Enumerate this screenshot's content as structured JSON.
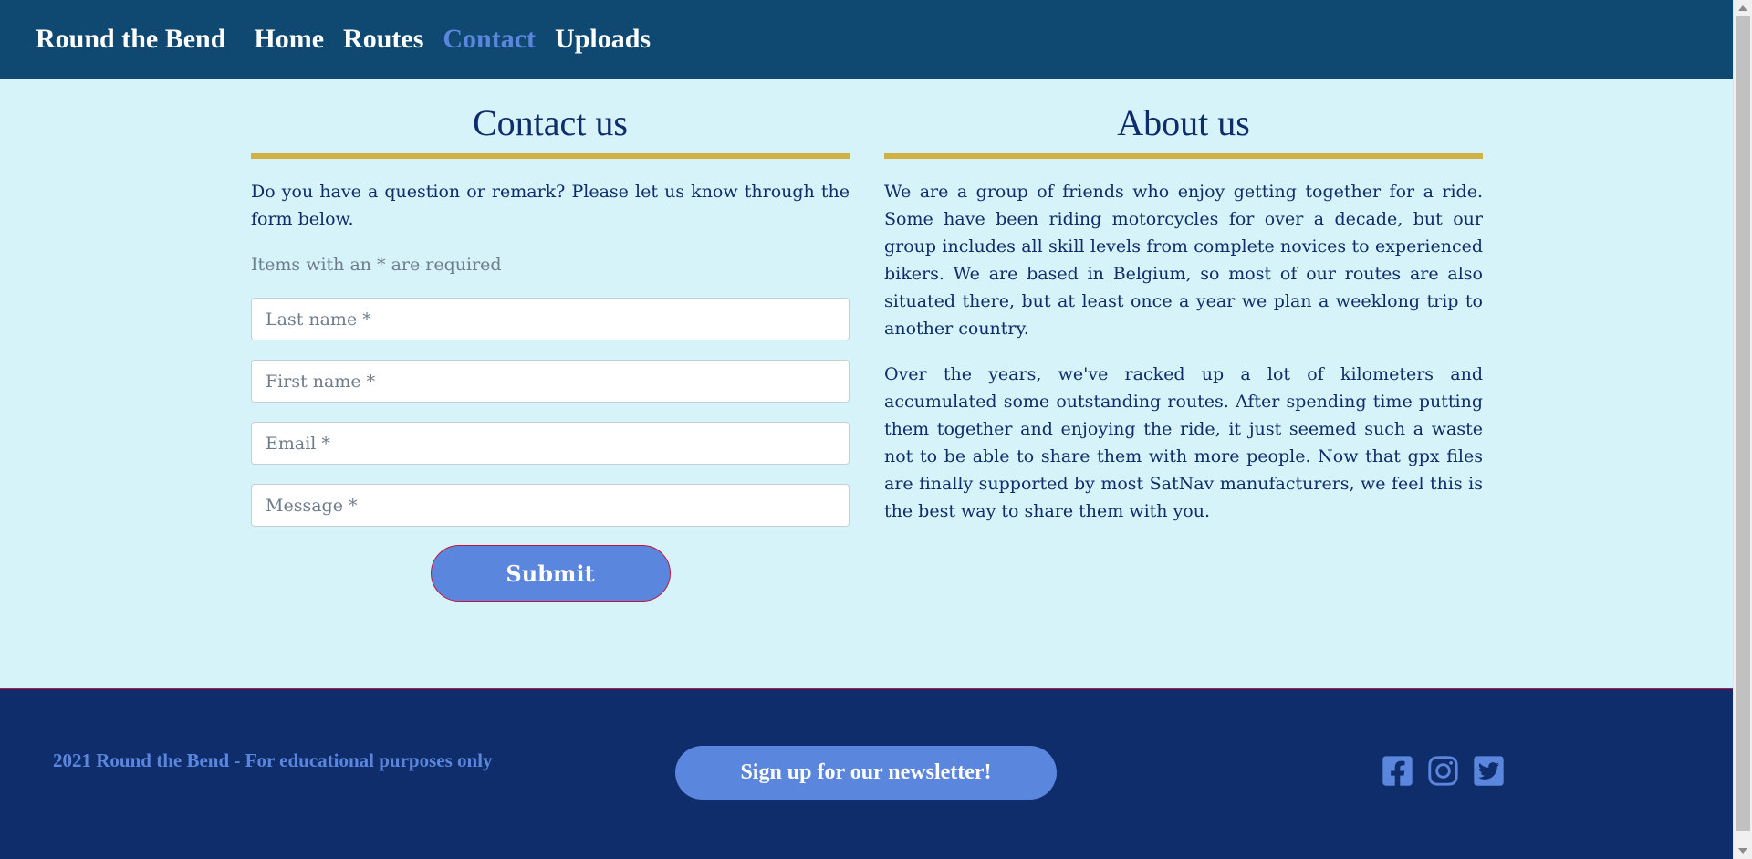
{
  "nav": {
    "brand": "Round the Bend",
    "links": [
      {
        "label": "Home"
      },
      {
        "label": "Routes"
      },
      {
        "label": "Contact"
      },
      {
        "label": "Uploads"
      }
    ]
  },
  "contact": {
    "title": "Contact us",
    "intro": "Do you have a question or remark? Please let us know through the form below.",
    "required_note": "Items with an * are required",
    "fields": {
      "last_name": {
        "placeholder": "Last name *",
        "value": ""
      },
      "first_name": {
        "placeholder": "First name *",
        "value": ""
      },
      "email": {
        "placeholder": "Email *",
        "value": ""
      },
      "message": {
        "placeholder": "Message *",
        "value": ""
      }
    },
    "submit_label": "Submit"
  },
  "about": {
    "title": "About us",
    "paragraphs": [
      "We are a group of friends who enjoy getting together for a ride. Some have been riding motorcycles for over a decade, but our group includes all skill levels from complete novices to experienced bikers. We are based in Belgium, so most of our routes are also situated there, but at least once a year we plan a weeklong trip to another country.",
      "Over the years, we've racked up a lot of kilometers and accumulated some outstanding routes. After spending time putting them together and enjoying the ride, it just seemed such a waste not to be able to share them with more people. Now that gpx files are finally supported by most SatNav manufacturers, we feel this is the best way to share them with you."
    ]
  },
  "footer": {
    "copyright": "2021 Round the Bend - For educational purposes only",
    "newsletter_label": "Sign up for our newsletter!",
    "socials": [
      {
        "icon": "facebook-icon"
      },
      {
        "icon": "instagram-icon"
      },
      {
        "icon": "twitter-icon"
      }
    ]
  },
  "colors": {
    "nav_bg": "#0f4870",
    "body_bg": "#d6f3f9",
    "footer_bg": "#0f2c6b",
    "accent": "#5b86dd",
    "gold": "#d1b143",
    "text": "#0f2c6b",
    "border_red": "#c4163c"
  }
}
